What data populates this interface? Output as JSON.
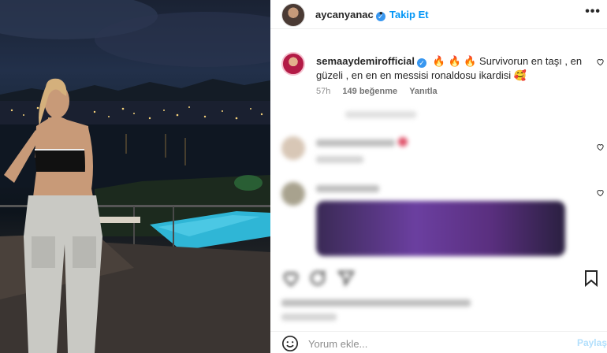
{
  "post_author": {
    "username": "aycanyanac",
    "separator": "•",
    "follow_label": "Takip Et",
    "more_label": "•••"
  },
  "comment": {
    "username": "semaaydemirofficial",
    "text": "🔥 🔥 🔥 Survivorun en taşı , en güzeli , en en en messisi ronaldosu ikardisi 🥰",
    "time": "57h",
    "likes": "149 beğenme",
    "reply_label": "Yanıtla"
  },
  "footer": {
    "placeholder": "Yorum ekle...",
    "post_label": "Paylaş"
  },
  "icons": {
    "verified": "verified-badge-icon",
    "heart": "heart-icon",
    "like": "like-heart-icon",
    "comment": "comment-icon",
    "share": "share-icon",
    "save": "bookmark-icon",
    "emoji": "emoji-icon",
    "more": "more-icon"
  },
  "colors": {
    "accent": "#0095f6",
    "verified": "#3897f0",
    "muted": "#8e8e8e"
  }
}
